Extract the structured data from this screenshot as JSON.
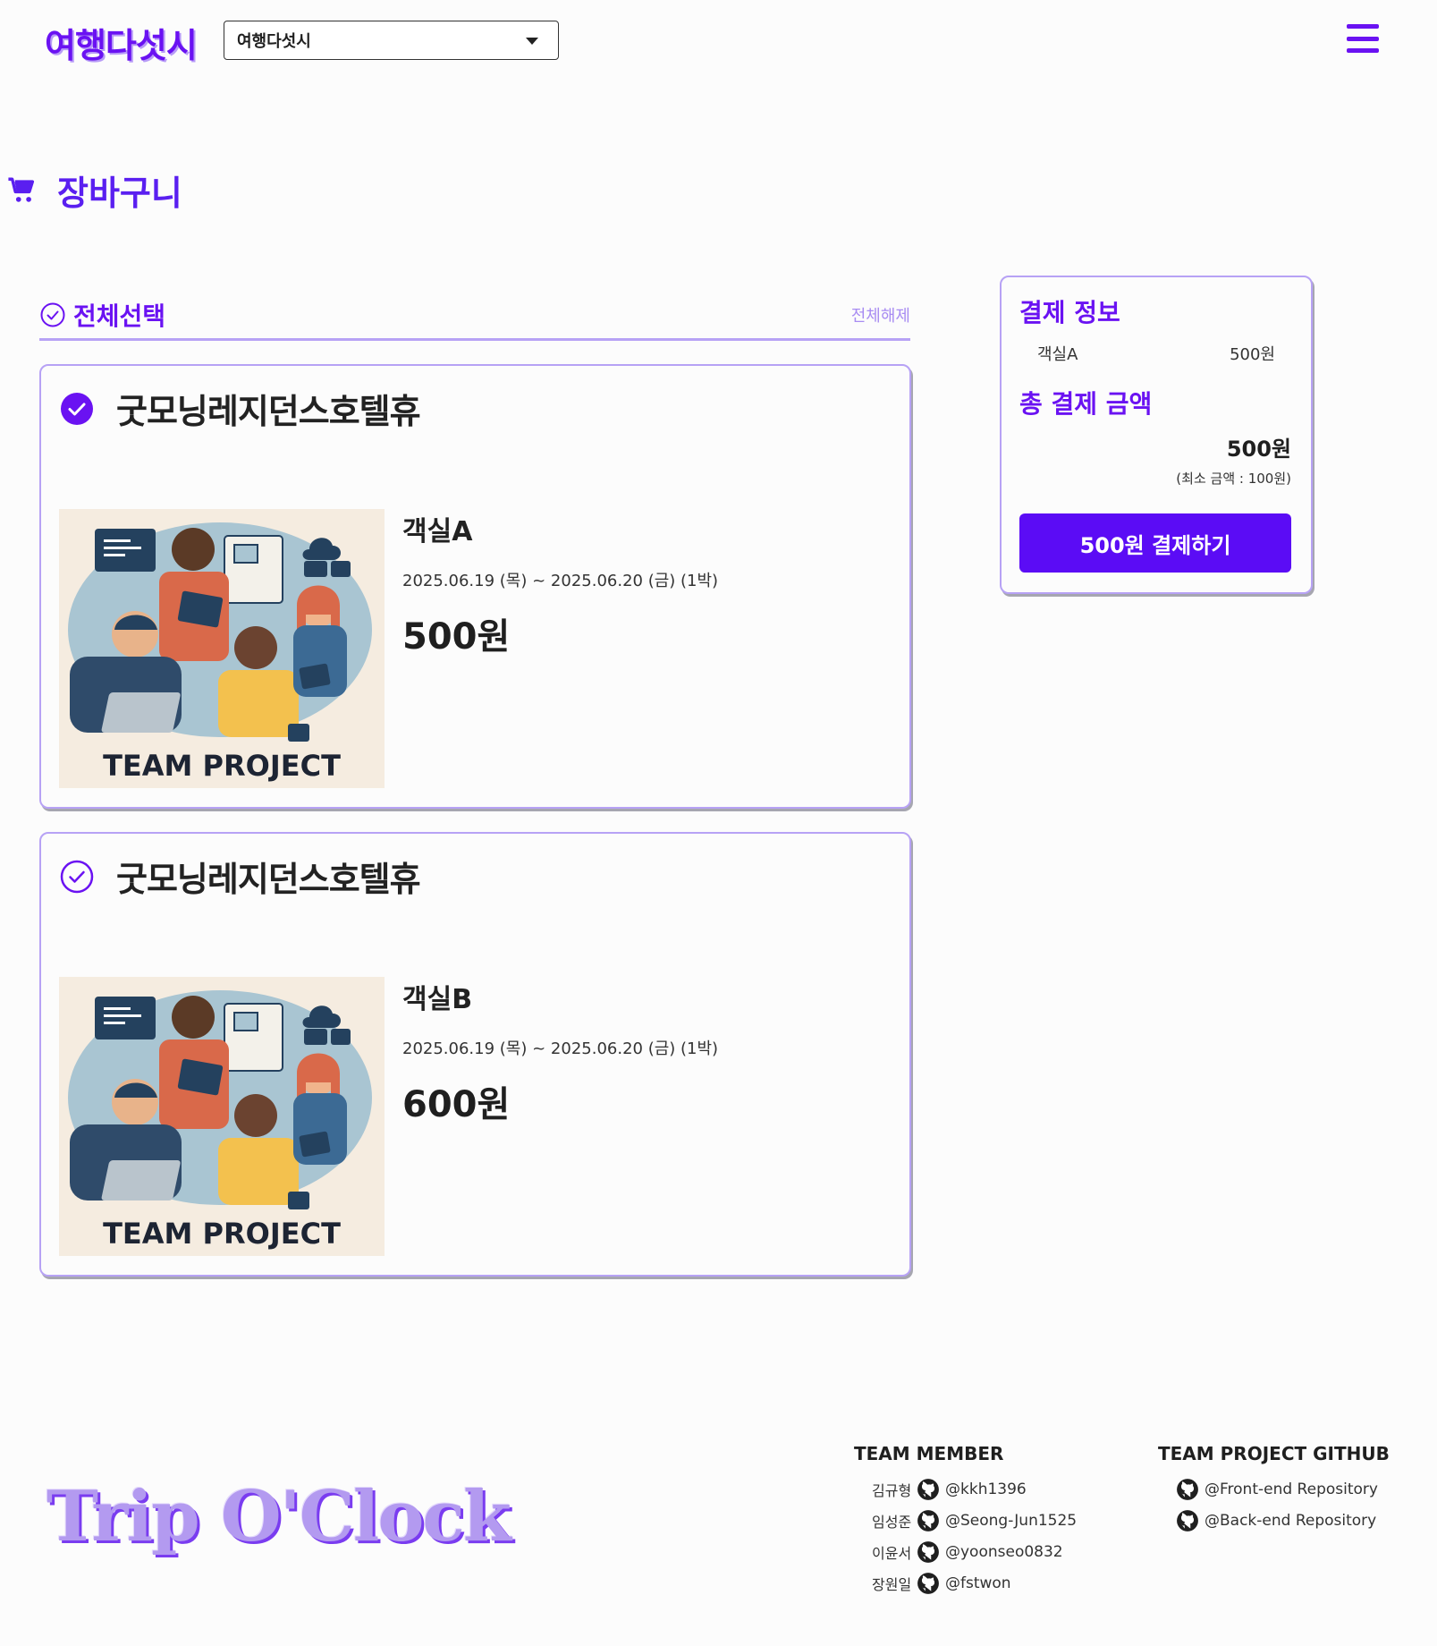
{
  "header": {
    "logo": "여행다섯시",
    "site_select_value": "여행다섯시"
  },
  "page": {
    "title": "장바구니"
  },
  "cart": {
    "select_all_label": "전체선택",
    "deselect_all_label": "전체해제",
    "items": [
      {
        "hotel": "굿모닝레지던스호텔휴",
        "room": "객실A",
        "dates": "2025.06.19 (목) ~ 2025.06.20 (금) (1박)",
        "price": "500원",
        "image_caption": "TEAM PROJECT",
        "checked": true
      },
      {
        "hotel": "굿모닝레지던스호텔휴",
        "room": "객실B",
        "dates": "2025.06.19 (목) ~ 2025.06.20 (금) (1박)",
        "price": "600원",
        "image_caption": "TEAM PROJECT",
        "checked": false
      }
    ]
  },
  "payment": {
    "title": "결제 정보",
    "line_label": "객실A",
    "line_amount": "500원",
    "total_title": "총 결제 금액",
    "total_amount": "500원",
    "min_note": "(최소 금액 : 100원)",
    "pay_button": "500원 결제하기"
  },
  "footer": {
    "brand": "Trip O'Clock",
    "members_title": "TEAM MEMBER",
    "members": [
      {
        "name": "김규형",
        "handle": "@kkh1396"
      },
      {
        "name": "임성준",
        "handle": "@Seong-Jun1525"
      },
      {
        "name": "이윤서",
        "handle": "@yoonseo0832"
      },
      {
        "name": "장원일",
        "handle": "@fstwon"
      }
    ],
    "repos_title": "TEAM PROJECT GITHUB",
    "repos": [
      {
        "label": "@Front-end Repository"
      },
      {
        "label": "@Back-end Repository"
      }
    ]
  },
  "colors": {
    "accent": "#6a12f2",
    "button": "#5b0cf5",
    "border": "#b7a2f5"
  }
}
